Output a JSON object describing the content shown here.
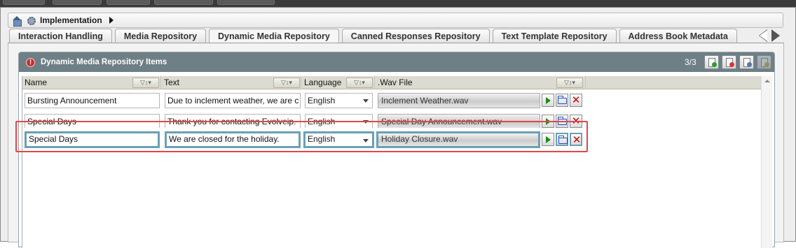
{
  "breadcrumb": {
    "label": "Implementation"
  },
  "tabs": [
    {
      "label": "Interaction Handling",
      "active": false
    },
    {
      "label": "Media Repository",
      "active": false
    },
    {
      "label": "Dynamic Media Repository",
      "active": true
    },
    {
      "label": "Canned Responses Repository",
      "active": false
    },
    {
      "label": "Text Template Repository",
      "active": false
    },
    {
      "label": "Address Book Metadata",
      "active": false
    }
  ],
  "panel": {
    "title": "Dynamic Media Repository Items",
    "count": "3/3",
    "toolbar": [
      "add-item-icon",
      "delete-item-icon",
      "copy-item-icon",
      "settings-icon"
    ]
  },
  "grid": {
    "columns": [
      {
        "label": "Name"
      },
      {
        "label": "Text"
      },
      {
        "label": "Language"
      },
      {
        "label": ".Wav File"
      }
    ],
    "filter_glyph": "▽↕▾",
    "rows": [
      {
        "name": "Bursting Announcement",
        "text": "Due to inclement weather, we are c",
        "language": "English",
        "wav": "Inclement Weather.wav"
      },
      {
        "name": "Special Days",
        "text": "Thank you for contacting Evolveip.",
        "language": "English",
        "wav": "Special Day Announcement.wav"
      },
      {
        "name": "Special Days",
        "text": "We are closed for the holiday.",
        "language": "English",
        "wav": "Holiday Closure.wav"
      }
    ],
    "delete_glyph": "✕"
  },
  "colors": {
    "header_bg": "#6e7f86",
    "selection_border": "#6aa0b6",
    "highlight_box": "#e0484b",
    "play_green": "#1c8a1c",
    "delete_red": "#d40000"
  }
}
